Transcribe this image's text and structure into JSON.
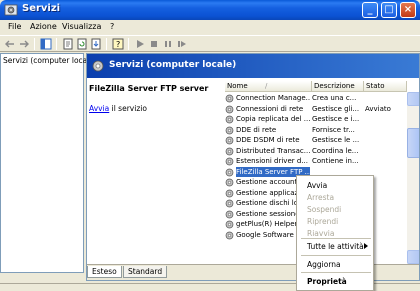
{
  "window": {
    "title": "Servizi",
    "buttons": {
      "minimize": "_",
      "maximize": "□",
      "close": "×"
    }
  },
  "menubar": {
    "items": [
      {
        "label": "File"
      },
      {
        "label": "Azione"
      },
      {
        "label": "Visualizza"
      },
      {
        "label": "?"
      }
    ]
  },
  "tree": {
    "root_label": "Servizi (computer locale)"
  },
  "banner": {
    "title": "Servizi (computer locale)"
  },
  "details": {
    "service_name": "FileZilla Server FTP server",
    "start_link": "Avvia",
    "start_suffix": " il servizio"
  },
  "listview": {
    "columns": [
      {
        "label": "Nome",
        "sort_glyph": "/"
      },
      {
        "label": "Descrizione"
      },
      {
        "label": "Stato"
      }
    ],
    "rows": [
      {
        "name": "Connection Manage...",
        "desc": "Crea una c...",
        "status": ""
      },
      {
        "name": "Connessioni di rete",
        "desc": "Gestisce gli...",
        "status": "Avviato"
      },
      {
        "name": "Copia replicata del ...",
        "desc": "Gestisce e i...",
        "status": ""
      },
      {
        "name": "DDE di rete",
        "desc": "Fornisce tr...",
        "status": ""
      },
      {
        "name": "DDE DSDM di rete",
        "desc": "Gestisce le ...",
        "status": ""
      },
      {
        "name": "Distributed Transac...",
        "desc": "Coordina le...",
        "status": ""
      },
      {
        "name": "Estensioni driver d...",
        "desc": "Contiene in...",
        "status": ""
      },
      {
        "name": "FileZilla Server FTP ...",
        "desc": "",
        "status": ""
      },
      {
        "name": "Gestione account",
        "desc": "",
        "status": ""
      },
      {
        "name": "Gestione applicazi",
        "desc": "",
        "status": ""
      },
      {
        "name": "Gestione dischi log",
        "desc": "",
        "status": ""
      },
      {
        "name": "Gestione sessione",
        "desc": "",
        "status": ""
      },
      {
        "name": "getPlus(R) Helper",
        "desc": "",
        "status": ""
      },
      {
        "name": "Google Software U",
        "desc": "",
        "status": ""
      }
    ]
  },
  "tabs": [
    {
      "label": "Esteso"
    },
    {
      "label": "Standard"
    }
  ],
  "context_menu": {
    "items": [
      {
        "label": "Avvia",
        "enabled": true
      },
      {
        "label": "Arresta",
        "enabled": false
      },
      {
        "label": "Sospendi",
        "enabled": false
      },
      {
        "label": "Riprendi",
        "enabled": false
      },
      {
        "label": "Riavvia",
        "enabled": false
      },
      {
        "label": "Tutte le attività",
        "enabled": true
      },
      {
        "label": "Aggiorna",
        "enabled": true
      },
      {
        "label": "Proprietà",
        "enabled": true
      }
    ]
  },
  "colors": {
    "titlebar": "#0b52d3",
    "selection": "#316ac5",
    "link": "#0000ee"
  }
}
